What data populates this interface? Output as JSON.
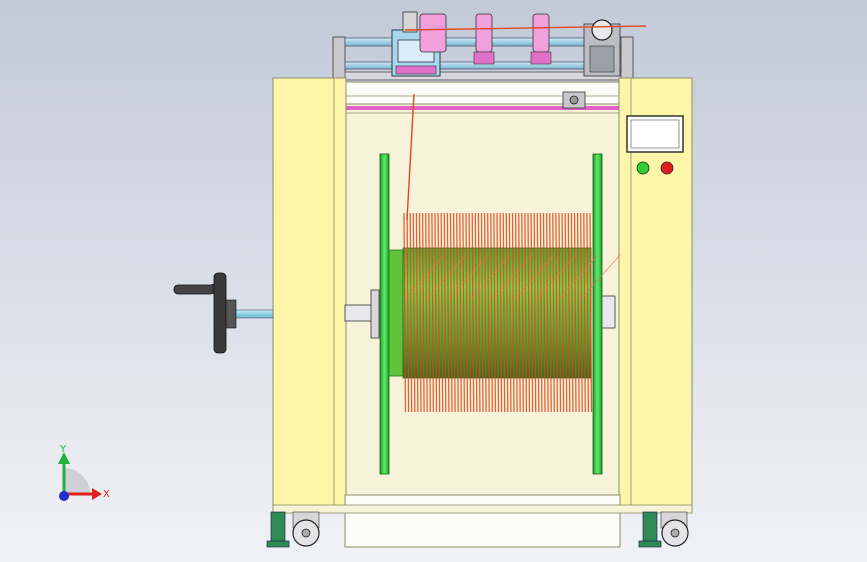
{
  "window": {
    "background_top": "#c2cad8",
    "background_bottom": "#f1f2f6"
  },
  "machine": {
    "frame_color": "#fdf6a8",
    "frame_edge": "#8c8c6a",
    "inner_panel_color": "#f8f5df",
    "flange_color": "#3fd44a",
    "drum_color": "#5ec23a",
    "wire_color": "#e0481f",
    "pink_rail_color": "#e060c8",
    "shaft_color": "#9ed8ea",
    "handwheel_color": "#3a3a3a",
    "start_button_color": "#2fcf2f",
    "stop_button_color": "#e02020",
    "screen_color": "#ffffff",
    "caster_color": "#cfcfcf",
    "leveling_foot_color": "#2f8a55"
  },
  "triad": {
    "x_label": "X",
    "y_label": "Y",
    "x_color": "#e02020",
    "y_color": "#20b040",
    "z_color": "#2030d0"
  }
}
